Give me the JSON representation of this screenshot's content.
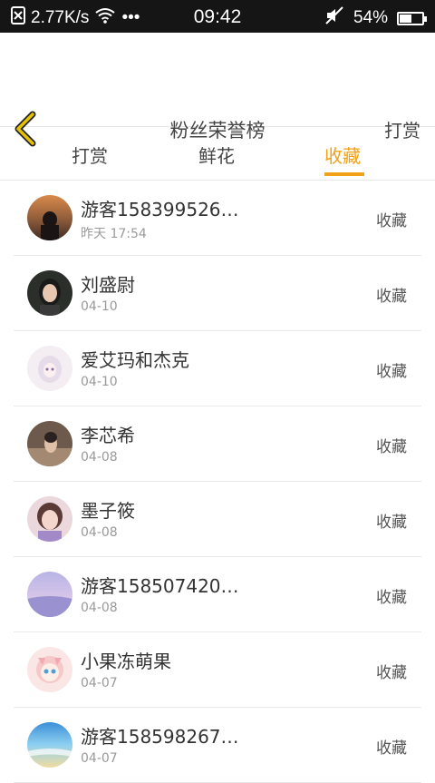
{
  "status_bar": {
    "net_speed": "2.77K/s",
    "dots": "•••",
    "time": "09:42",
    "battery": "54%",
    "battery_level": 0.54
  },
  "header": {
    "title": "粉丝荣誉榜",
    "action": "打赏"
  },
  "tabs": [
    {
      "label": "打赏",
      "active": false
    },
    {
      "label": "鲜花",
      "active": false
    },
    {
      "label": "收藏",
      "active": true
    }
  ],
  "colors": {
    "accent": "#f0a118",
    "back_arrow": "#e6c300"
  },
  "list": [
    {
      "name": "游客158399526…",
      "date": "昨天 17:54",
      "action": "收藏"
    },
    {
      "name": "刘盛尉",
      "date": "04-10",
      "action": "收藏"
    },
    {
      "name": "爱艾玛和杰克",
      "date": "04-10",
      "action": "收藏"
    },
    {
      "name": "李芯希",
      "date": "04-08",
      "action": "收藏"
    },
    {
      "name": "墨子筱",
      "date": "04-08",
      "action": "收藏"
    },
    {
      "name": "游客158507420…",
      "date": "04-08",
      "action": "收藏"
    },
    {
      "name": "小果冻萌果",
      "date": "04-07",
      "action": "收藏"
    },
    {
      "name": "游客158598267…",
      "date": "04-07",
      "action": "收藏"
    }
  ]
}
